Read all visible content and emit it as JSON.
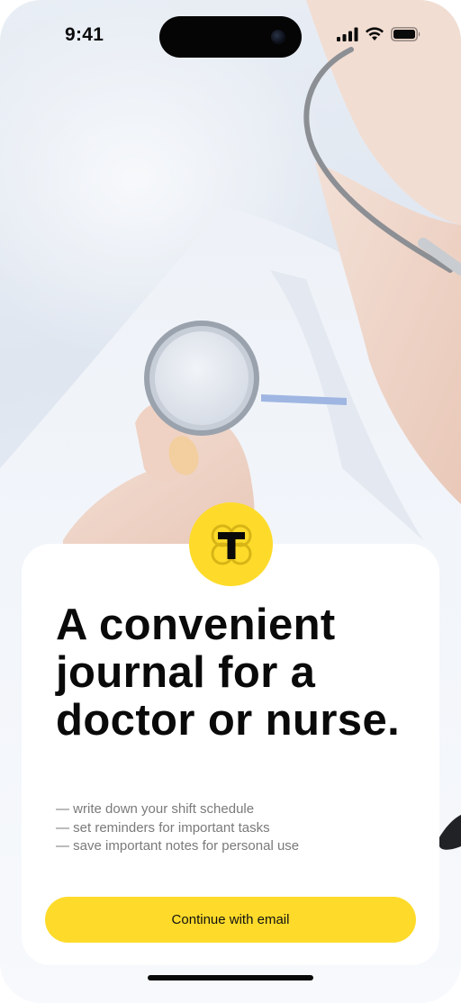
{
  "status_bar": {
    "time": "9:41",
    "signal_icon": "cellular-signal-icon",
    "wifi_icon": "wifi-icon",
    "battery_icon": "battery-icon"
  },
  "background": {
    "image": "doctor-with-stethoscope-photo"
  },
  "brand": {
    "logo_icon": "journal-t-logo-icon",
    "accent_color": "#FEDB2A"
  },
  "onboarding": {
    "headline": "A convenient journal for a doctor or nurse.",
    "features": [
      "— write down your shift schedule",
      "— set reminders for important tasks",
      "— save important notes for personal use"
    ],
    "cta_label": "Continue with email"
  }
}
